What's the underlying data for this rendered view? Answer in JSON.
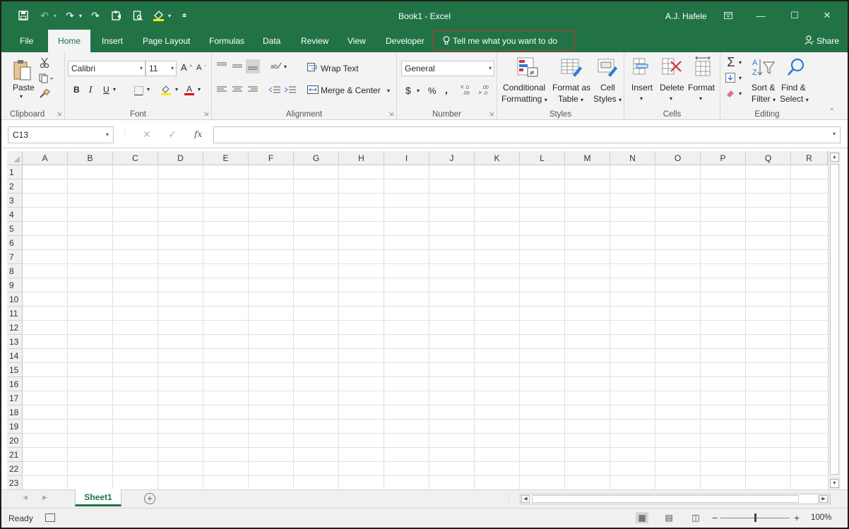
{
  "titlebar": {
    "title": "Book1  -  Excel",
    "user": "A.J. Hafele",
    "qat_icons": [
      "save-icon",
      "undo-icon",
      "redo-icon",
      "redo-icon",
      "paste-special-icon",
      "print-preview-icon",
      "fill-color-icon",
      "customize-icon"
    ],
    "window_controls": [
      "ribbon-display-icon",
      "minimize-icon",
      "maximize-icon",
      "close-icon"
    ]
  },
  "tabs": [
    {
      "label": "File"
    },
    {
      "label": "Home"
    },
    {
      "label": "Insert"
    },
    {
      "label": "Page Layout"
    },
    {
      "label": "Formulas"
    },
    {
      "label": "Data"
    },
    {
      "label": "Review"
    },
    {
      "label": "View"
    },
    {
      "label": "Developer"
    }
  ],
  "tell_me": "Tell me what you want to do",
  "share": "Share",
  "ribbon": {
    "clipboard": {
      "label": "Clipboard",
      "paste": "Paste"
    },
    "font": {
      "label": "Font",
      "font_name": "Calibri",
      "font_size": "11"
    },
    "alignment": {
      "label": "Alignment",
      "wrap_text": "Wrap Text",
      "merge_center": "Merge & Center"
    },
    "number": {
      "label": "Number",
      "format": "General"
    },
    "styles": {
      "label": "Styles",
      "conditional_1": "Conditional",
      "conditional_2": "Formatting",
      "format_table_1": "Format as",
      "format_table_2": "Table",
      "cell_styles_1": "Cell",
      "cell_styles_2": "Styles"
    },
    "cells": {
      "label": "Cells",
      "insert": "Insert",
      "delete": "Delete",
      "format": "Format"
    },
    "editing": {
      "label": "Editing",
      "sort_1": "Sort &",
      "sort_2": "Filter",
      "find_1": "Find &",
      "find_2": "Select"
    }
  },
  "formula_bar": {
    "name_box": "C13",
    "content": ""
  },
  "grid": {
    "columns": [
      "A",
      "B",
      "C",
      "D",
      "E",
      "F",
      "G",
      "H",
      "I",
      "J",
      "K",
      "L",
      "M",
      "N",
      "O",
      "P",
      "Q",
      "R"
    ],
    "rows": [
      "1",
      "2",
      "3",
      "4",
      "5",
      "6",
      "7",
      "8",
      "9",
      "10",
      "11",
      "12",
      "13",
      "14",
      "15",
      "16",
      "17",
      "18",
      "19",
      "20",
      "21",
      "22",
      "23"
    ]
  },
  "sheets": [
    {
      "name": "Sheet1",
      "active": true
    }
  ],
  "status": {
    "ready": "Ready",
    "zoom": "100%"
  },
  "colors": {
    "accent": "#217346",
    "tellme_highlight": "#d62a2a"
  }
}
